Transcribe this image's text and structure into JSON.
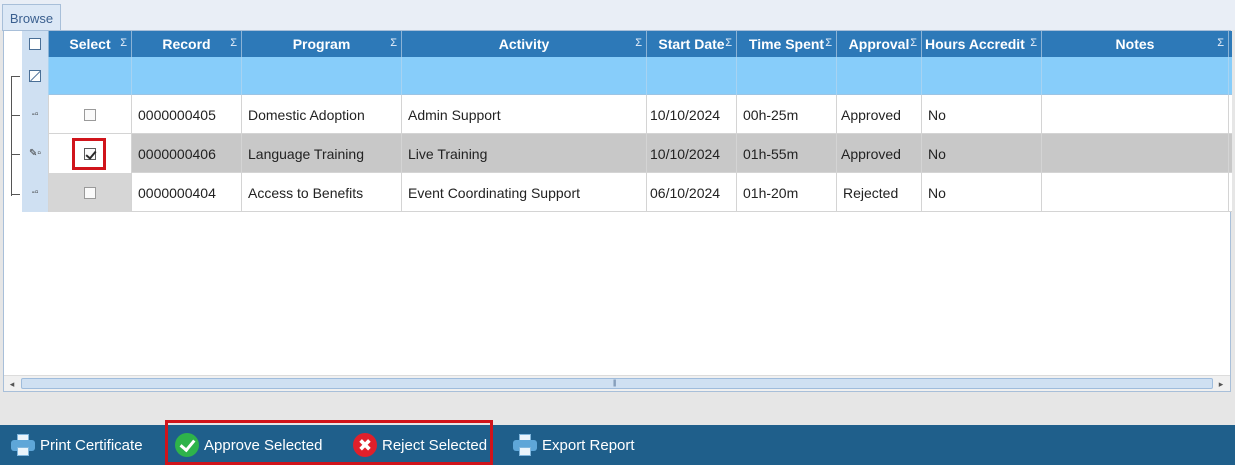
{
  "tab": {
    "label": "Browse"
  },
  "columns": [
    {
      "label": "Select",
      "sigma": "Σ"
    },
    {
      "label": "Record",
      "sigma": "Σ"
    },
    {
      "label": "Program",
      "sigma": "Σ"
    },
    {
      "label": "Activity",
      "sigma": "Σ"
    },
    {
      "label": "Start Date",
      "sigma": "Σ"
    },
    {
      "label": "Time Spent",
      "sigma": "Σ"
    },
    {
      "label": "Approval",
      "sigma": "Σ"
    },
    {
      "label": "Hours Accredit",
      "sigma": "Σ"
    },
    {
      "label": "Notes",
      "sigma": "Σ"
    }
  ],
  "rows": [
    {
      "selected": false,
      "record": "0000000405",
      "program": "Domestic Adoption",
      "activity": "Admin Support",
      "start_date": "10/10/2024",
      "time_spent": "00h-25m",
      "approval": "Approved",
      "hours_accredited": "No",
      "notes": ""
    },
    {
      "selected": true,
      "record": "0000000406",
      "program": "Language Training",
      "activity": "Live Training",
      "start_date": "10/10/2024",
      "time_spent": "01h-55m",
      "approval": "Approved",
      "hours_accredited": "No",
      "notes": ""
    },
    {
      "selected": false,
      "record": "0000000404",
      "program": "Access to Benefits",
      "activity": "Event Coordinating Support",
      "start_date": "06/10/2024",
      "time_spent": "01h-20m",
      "approval": "Rejected",
      "hours_accredited": "No",
      "notes": ""
    }
  ],
  "scrollbar": {
    "left_arrow": "◂",
    "right_arrow": "▸",
    "grip": "|||"
  },
  "toolbar": {
    "print_certificate": "Print Certificate",
    "approve_selected": "Approve Selected",
    "reject_selected": "Reject Selected",
    "export_report": "Export Report"
  },
  "icons": {
    "print": "printer-icon",
    "approve": "check-circle-icon",
    "reject": "x-circle-icon",
    "export": "printer-icon",
    "edit": "pencil-icon",
    "reject_glyph": "✖"
  },
  "colors": {
    "header": "#2d79b8",
    "filter_row": "#87cdfa",
    "toolbar": "#1f5f8b",
    "highlight": "#d0141b",
    "approve": "#2eb34a",
    "reject": "#e0202b"
  }
}
